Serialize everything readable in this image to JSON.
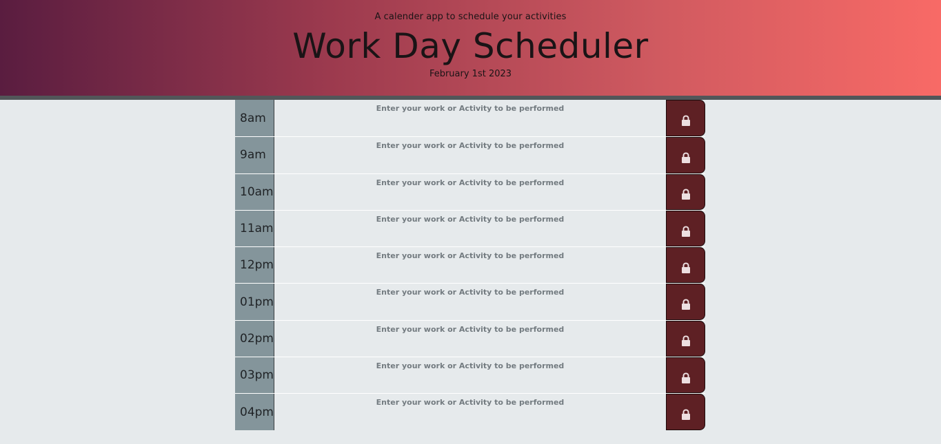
{
  "header": {
    "tagline": "A calender app to schedule your activities",
    "title": "Work Day Scheduler",
    "date": "February 1st 2023"
  },
  "icons": {
    "save": "lock-icon"
  },
  "colors": {
    "hour_bg": "#84959b",
    "save_bg": "#5e2024",
    "page_bg": "#e6eaec"
  },
  "slots": [
    {
      "hour": "8am",
      "placeholder": "Enter your work or Activity to be performed",
      "value": ""
    },
    {
      "hour": "9am",
      "placeholder": "Enter your work or Activity to be performed",
      "value": ""
    },
    {
      "hour": "10am",
      "placeholder": "Enter your work or Activity to be performed",
      "value": ""
    },
    {
      "hour": "11am",
      "placeholder": "Enter your work or Activity to be performed",
      "value": ""
    },
    {
      "hour": "12pm",
      "placeholder": "Enter your work or Activity to be performed",
      "value": ""
    },
    {
      "hour": "01pm",
      "placeholder": "Enter your work or Activity to be performed",
      "value": ""
    },
    {
      "hour": "02pm",
      "placeholder": "Enter your work or Activity to be performed",
      "value": ""
    },
    {
      "hour": "03pm",
      "placeholder": "Enter your work or Activity to be performed",
      "value": ""
    },
    {
      "hour": "04pm",
      "placeholder": "Enter your work or Activity to be performed",
      "value": ""
    }
  ]
}
